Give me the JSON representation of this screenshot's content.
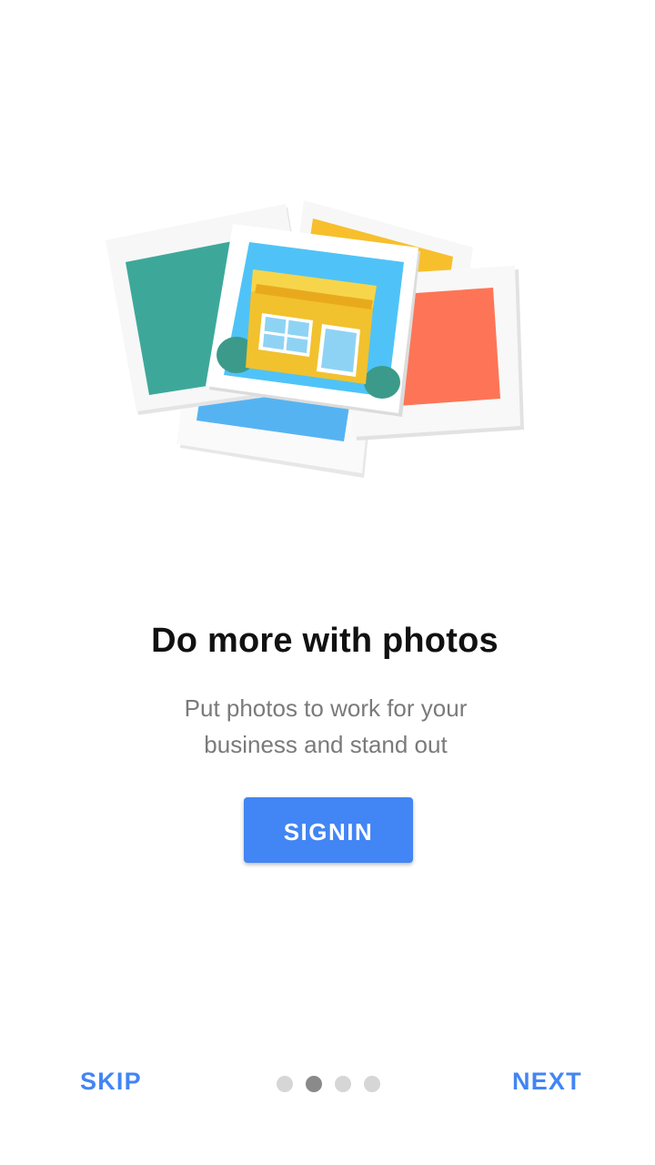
{
  "onboarding": {
    "illustration_icon": "stacked-photos-storefront-illustration",
    "headline": "Do more with photos",
    "subtitle_line1": "Put photos to work for your",
    "subtitle_line2": "business and stand out",
    "signin_label": "SIGNIN"
  },
  "footer": {
    "skip_label": "SKIP",
    "next_label": "NEXT",
    "page_count": 4,
    "active_page": 2
  },
  "colors": {
    "accent": "#4285f4",
    "headline": "#111111",
    "subtitle": "#7a7a7a",
    "dot_inactive": "#d6d6d6",
    "dot_active": "#8a8a8a"
  }
}
